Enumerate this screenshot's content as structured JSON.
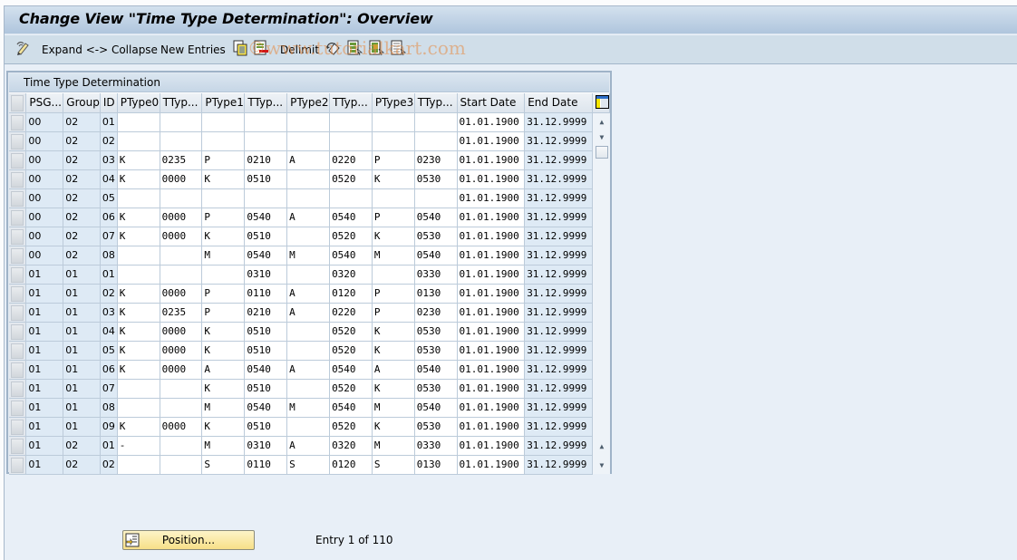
{
  "window": {
    "title": "Change View \"Time Type Determination\": Overview"
  },
  "toolbar": {
    "items": [
      {
        "type": "icon",
        "icon": "display-change-icon"
      },
      {
        "type": "button",
        "label": "Expand <-> Collapse"
      },
      {
        "type": "button",
        "label": "New Entries"
      },
      {
        "type": "icon",
        "icon": "copy-as-icon"
      },
      {
        "type": "icon",
        "icon": "delete-icon"
      },
      {
        "type": "button",
        "label": "Delimit"
      },
      {
        "type": "icon",
        "icon": "undo-change-icon"
      },
      {
        "type": "icon",
        "icon": "select-all-icon"
      },
      {
        "type": "icon",
        "icon": "select-block-icon"
      },
      {
        "type": "icon",
        "icon": "deselect-all-icon"
      }
    ],
    "expand_label": "Expand <-> Collapse",
    "new_entries_label": "New Entries",
    "delimit_label": "Delimit",
    "watermark": "©www.tutorialkart.com"
  },
  "table": {
    "title": "Time Type Determination",
    "columns": [
      "PSG...",
      "Group",
      "ID",
      "PType0",
      "TTyp...",
      "PType1",
      "TTyp...",
      "PType2",
      "TTyp...",
      "PType3",
      "TTyp...",
      "Start Date",
      "End Date"
    ],
    "rows": [
      [
        "00",
        "02",
        "01",
        "",
        "",
        "",
        "",
        "",
        "",
        "",
        "",
        "01.01.1900",
        "31.12.9999"
      ],
      [
        "00",
        "02",
        "02",
        "",
        "",
        "",
        "",
        "",
        "",
        "",
        "",
        "01.01.1900",
        "31.12.9999"
      ],
      [
        "00",
        "02",
        "03",
        "K",
        "0235",
        "P",
        "0210",
        "A",
        "0220",
        "P",
        "0230",
        "01.01.1900",
        "31.12.9999"
      ],
      [
        "00",
        "02",
        "04",
        "K",
        "0000",
        "K",
        "0510",
        "",
        "0520",
        "K",
        "0530",
        "01.01.1900",
        "31.12.9999"
      ],
      [
        "00",
        "02",
        "05",
        "",
        "",
        "",
        "",
        "",
        "",
        "",
        "",
        "01.01.1900",
        "31.12.9999"
      ],
      [
        "00",
        "02",
        "06",
        "K",
        "0000",
        "P",
        "0540",
        "A",
        "0540",
        "P",
        "0540",
        "01.01.1900",
        "31.12.9999"
      ],
      [
        "00",
        "02",
        "07",
        "K",
        "0000",
        "K",
        "0510",
        "",
        "0520",
        "K",
        "0530",
        "01.01.1900",
        "31.12.9999"
      ],
      [
        "00",
        "02",
        "08",
        "",
        "",
        "M",
        "0540",
        "M",
        "0540",
        "M",
        "0540",
        "01.01.1900",
        "31.12.9999"
      ],
      [
        "01",
        "01",
        "01",
        "",
        "",
        "",
        "0310",
        "",
        "0320",
        "",
        "0330",
        "01.01.1900",
        "31.12.9999"
      ],
      [
        "01",
        "01",
        "02",
        "K",
        "0000",
        "P",
        "0110",
        "A",
        "0120",
        "P",
        "0130",
        "01.01.1900",
        "31.12.9999"
      ],
      [
        "01",
        "01",
        "03",
        "K",
        "0235",
        "P",
        "0210",
        "A",
        "0220",
        "P",
        "0230",
        "01.01.1900",
        "31.12.9999"
      ],
      [
        "01",
        "01",
        "04",
        "K",
        "0000",
        "K",
        "0510",
        "",
        "0520",
        "K",
        "0530",
        "01.01.1900",
        "31.12.9999"
      ],
      [
        "01",
        "01",
        "05",
        "K",
        "0000",
        "K",
        "0510",
        "",
        "0520",
        "K",
        "0530",
        "01.01.1900",
        "31.12.9999"
      ],
      [
        "01",
        "01",
        "06",
        "K",
        "0000",
        "A",
        "0540",
        "A",
        "0540",
        "A",
        "0540",
        "01.01.1900",
        "31.12.9999"
      ],
      [
        "01",
        "01",
        "07",
        "",
        "",
        "K",
        "0510",
        "",
        "0520",
        "K",
        "0530",
        "01.01.1900",
        "31.12.9999"
      ],
      [
        "01",
        "01",
        "08",
        "",
        "",
        "M",
        "0540",
        "M",
        "0540",
        "M",
        "0540",
        "01.01.1900",
        "31.12.9999"
      ],
      [
        "01",
        "01",
        "09",
        "K",
        "0000",
        "K",
        "0510",
        "",
        "0520",
        "K",
        "0530",
        "01.01.1900",
        "31.12.9999"
      ],
      [
        "01",
        "02",
        "01",
        "-",
        "",
        "M",
        "0310",
        "A",
        "0320",
        "M",
        "0330",
        "01.01.1900",
        "31.12.9999"
      ],
      [
        "01",
        "02",
        "02",
        "",
        "",
        "S",
        "0110",
        "S",
        "0120",
        "S",
        "0130",
        "01.01.1900",
        "31.12.9999"
      ]
    ]
  },
  "footer": {
    "position_label": "Position...",
    "entry_info": "Entry 1 of 110"
  }
}
